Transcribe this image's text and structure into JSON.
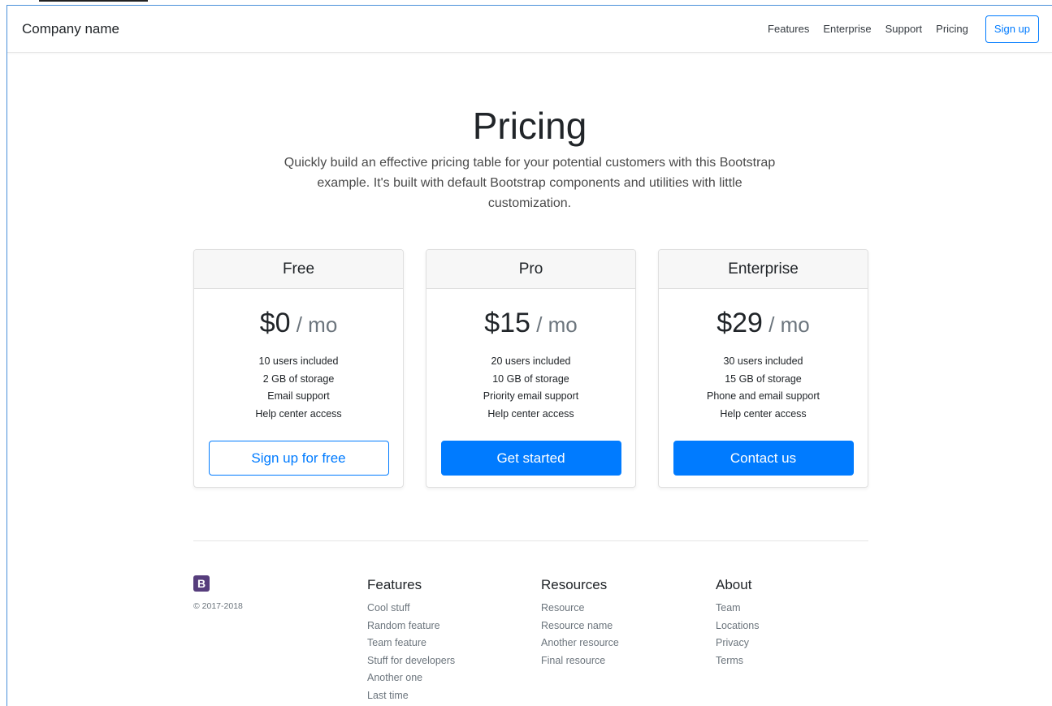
{
  "navbar": {
    "brand": "Company name",
    "links": [
      "Features",
      "Enterprise",
      "Support",
      "Pricing"
    ],
    "signup_label": "Sign up"
  },
  "hero": {
    "title": "Pricing",
    "lead": "Quickly build an effective pricing table for your potential customers with this Bootstrap example. It's built with default Bootstrap components and utilities with little customization."
  },
  "plans": [
    {
      "name": "Free",
      "price": "$0",
      "per": " / mo",
      "features": [
        "10 users included",
        "2 GB of storage",
        "Email support",
        "Help center access"
      ],
      "button": "Sign up for free"
    },
    {
      "name": "Pro",
      "price": "$15",
      "per": " / mo",
      "features": [
        "20 users included",
        "10 GB of storage",
        "Priority email support",
        "Help center access"
      ],
      "button": "Get started"
    },
    {
      "name": "Enterprise",
      "price": "$29",
      "per": " / mo",
      "features": [
        "30 users included",
        "15 GB of storage",
        "Phone and email support",
        "Help center access"
      ],
      "button": "Contact us"
    }
  ],
  "footer": {
    "logo_letter": "B",
    "copyright": "© 2017-2018",
    "columns": [
      {
        "title": "Features",
        "items": [
          "Cool stuff",
          "Random feature",
          "Team feature",
          "Stuff for developers",
          "Another one",
          "Last time"
        ]
      },
      {
        "title": "Resources",
        "items": [
          "Resource",
          "Resource name",
          "Another resource",
          "Final resource"
        ]
      },
      {
        "title": "About",
        "items": [
          "Team",
          "Locations",
          "Privacy",
          "Terms"
        ]
      }
    ]
  },
  "colors": {
    "primary": "#007bff",
    "logo_bg": "#563d7c",
    "muted": "#6c757d"
  }
}
